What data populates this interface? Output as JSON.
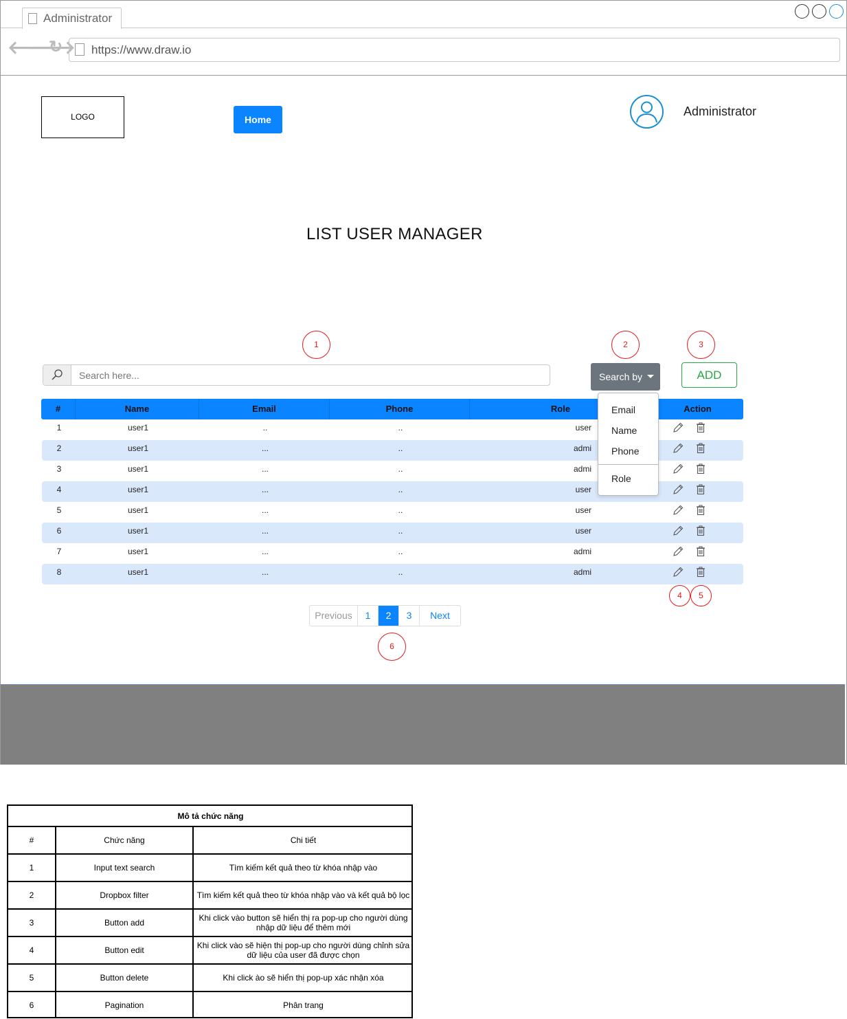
{
  "browser": {
    "tab_title": "Administrator",
    "url": "https://www.draw.io",
    "nav_icons": [
      "back-arrow-icon",
      "forward-arrow-icon",
      "reload-icon"
    ]
  },
  "header": {
    "logo_text": "LOGO",
    "home_label": "Home",
    "user_label": "Administrator"
  },
  "page_title": "LIST USER MANAGER",
  "markers": {
    "m1": "1",
    "m2": "2",
    "m3": "3",
    "m4": "4",
    "m5": "5",
    "m6": "6"
  },
  "search": {
    "placeholder": "Search here...",
    "searchby_label": "Search by",
    "add_label": "ADD"
  },
  "dropdown": {
    "items": [
      "Email",
      "Name",
      "Phone",
      "Role"
    ]
  },
  "table": {
    "headers": {
      "num": "#",
      "name": "Name",
      "email": "Email",
      "phone": "Phone",
      "role": "Role",
      "action": "Action"
    },
    "rows": [
      {
        "num": "1",
        "name": "user1",
        "email": "..",
        "phone": "..",
        "role": "user"
      },
      {
        "num": "2",
        "name": "user1",
        "email": "...",
        "phone": "..",
        "role": "admi"
      },
      {
        "num": "3",
        "name": "user1",
        "email": "...",
        "phone": "..",
        "role": "admi"
      },
      {
        "num": "4",
        "name": "user1",
        "email": "...",
        "phone": "..",
        "role": "user"
      },
      {
        "num": "5",
        "name": "user1",
        "email": "...",
        "phone": "..",
        "role": "user"
      },
      {
        "num": "6",
        "name": "user1",
        "email": "...",
        "phone": "..",
        "role": "user"
      },
      {
        "num": "7",
        "name": "user1",
        "email": "...",
        "phone": "..",
        "role": "admi"
      },
      {
        "num": "8",
        "name": "user1",
        "email": "...",
        "phone": "..",
        "role": "admi"
      }
    ]
  },
  "pagination": {
    "previous": "Previous",
    "pages": [
      "1",
      "2",
      "3"
    ],
    "active_page": "2",
    "next": "Next"
  },
  "accent": "#0a84ff",
  "row_alt_color": "#dae8fc",
  "marker_color": "#e31b1b",
  "description": {
    "title": "Mô tả chức năng",
    "headers": {
      "num": "#",
      "feature": "Chức năng",
      "detail": "Chi tiết"
    },
    "rows": [
      {
        "num": "1",
        "feature": "Input text search",
        "detail": "Tìm kiếm kết quả theo từ khóa nhập vào"
      },
      {
        "num": "2",
        "feature": "Dropbox filter",
        "detail": "Tìm kiếm kết quả theo từ khóa nhập vào và kết quả bộ lọc"
      },
      {
        "num": "3",
        "feature": "Button add",
        "detail": "Khi click vào button sẽ hiển thị ra pop-up cho người dùng nhập dữ liệu để thêm mới"
      },
      {
        "num": "4",
        "feature": "Button edit",
        "detail": "Khi click vào sẽ hiện thị pop-up cho người dùng chỉnh sửa dữ liệu của user đã được chọn"
      },
      {
        "num": "5",
        "feature": "Button delete",
        "detail": "Khi click ào sẽ hiển thị pop-up xác nhận xóa"
      },
      {
        "num": "6",
        "feature": "Pagination",
        "detail": "Phân trang"
      }
    ]
  }
}
